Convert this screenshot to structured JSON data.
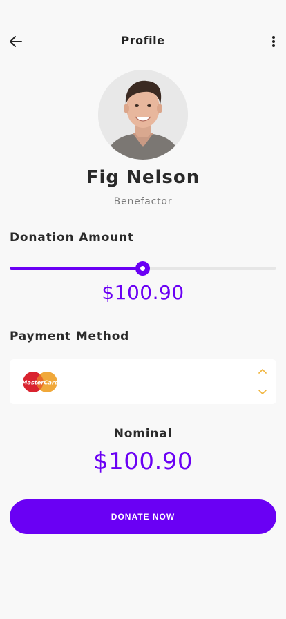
{
  "header": {
    "title": "Profile",
    "back_icon": "arrow-left-icon",
    "menu_icon": "more-vertical-icon"
  },
  "profile": {
    "name": "Fig Nelson",
    "role": "Benefactor"
  },
  "donation": {
    "label": "Donation Amount",
    "amount": "$100.90",
    "slider_fraction": 0.5
  },
  "payment": {
    "label": "Payment Method",
    "selected": "MasterCard",
    "up_icon": "chevron-up-icon",
    "down_icon": "chevron-down-icon"
  },
  "nominal": {
    "label": "Nominal",
    "amount": "$100.90"
  },
  "actions": {
    "donate_label": "DONATE NOW"
  },
  "colors": {
    "accent": "#6a00f4",
    "chevron": "#f0b43c",
    "mc_red": "#d9232f",
    "mc_yellow": "#f0a83a"
  }
}
